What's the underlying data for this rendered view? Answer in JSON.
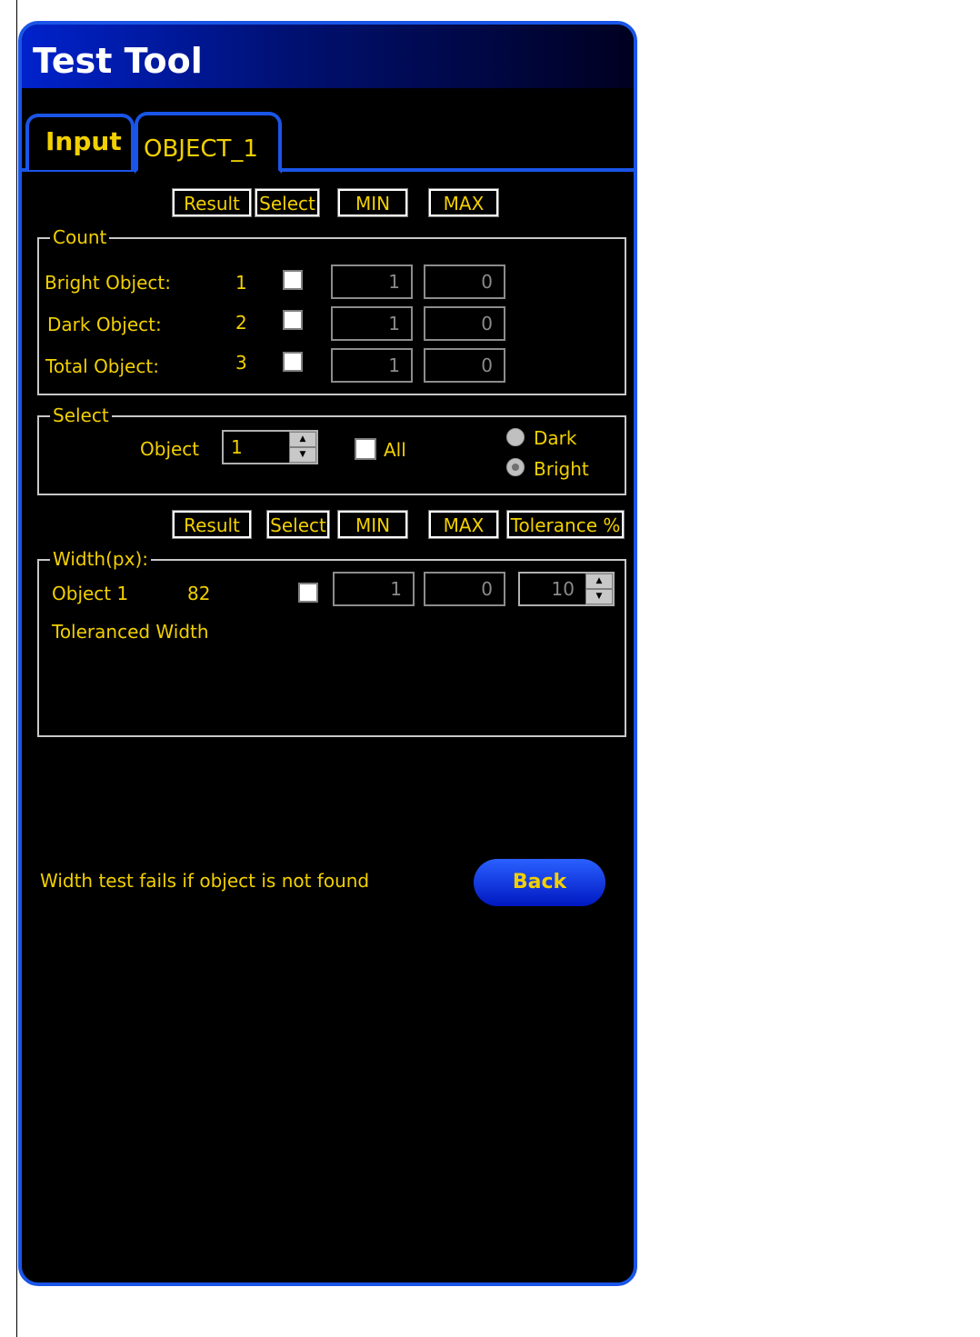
{
  "window": {
    "title": "Test Tool"
  },
  "tabs": [
    {
      "label": "Input"
    },
    {
      "label": "OBJECT_1"
    }
  ],
  "count_header": {
    "result": "Result",
    "select": "Select",
    "min": "MIN",
    "max": "MAX"
  },
  "count_group": {
    "title": "Count",
    "rows": [
      {
        "label": "Bright Object:",
        "result": "1",
        "min": "1",
        "max": "0"
      },
      {
        "label": "Dark Object:",
        "result": "2",
        "min": "1",
        "max": "0"
      },
      {
        "label": "Total Object:",
        "result": "3",
        "min": "1",
        "max": "0"
      }
    ]
  },
  "select_group": {
    "title": "Select",
    "object_label": "Object",
    "object_value": "1",
    "all_label": "All",
    "radio_dark": "Dark",
    "radio_bright": "Bright",
    "selected_radio": "Bright"
  },
  "width_header": {
    "result": "Result",
    "select": "Select",
    "min": "MIN",
    "max": "MAX",
    "tolerance": "Tolerance %"
  },
  "width_group": {
    "title": "Width(px):",
    "row_label": "Object 1",
    "row_result": "82",
    "min": "1",
    "max": "0",
    "tolerance": "10",
    "toleranced_label": "Toleranced Width"
  },
  "footer": {
    "note": "Width test fails if object is not found",
    "back_label": "Back"
  },
  "colors": {
    "accent": "#1a55e8",
    "text": "#f2d000",
    "background": "#000000"
  }
}
